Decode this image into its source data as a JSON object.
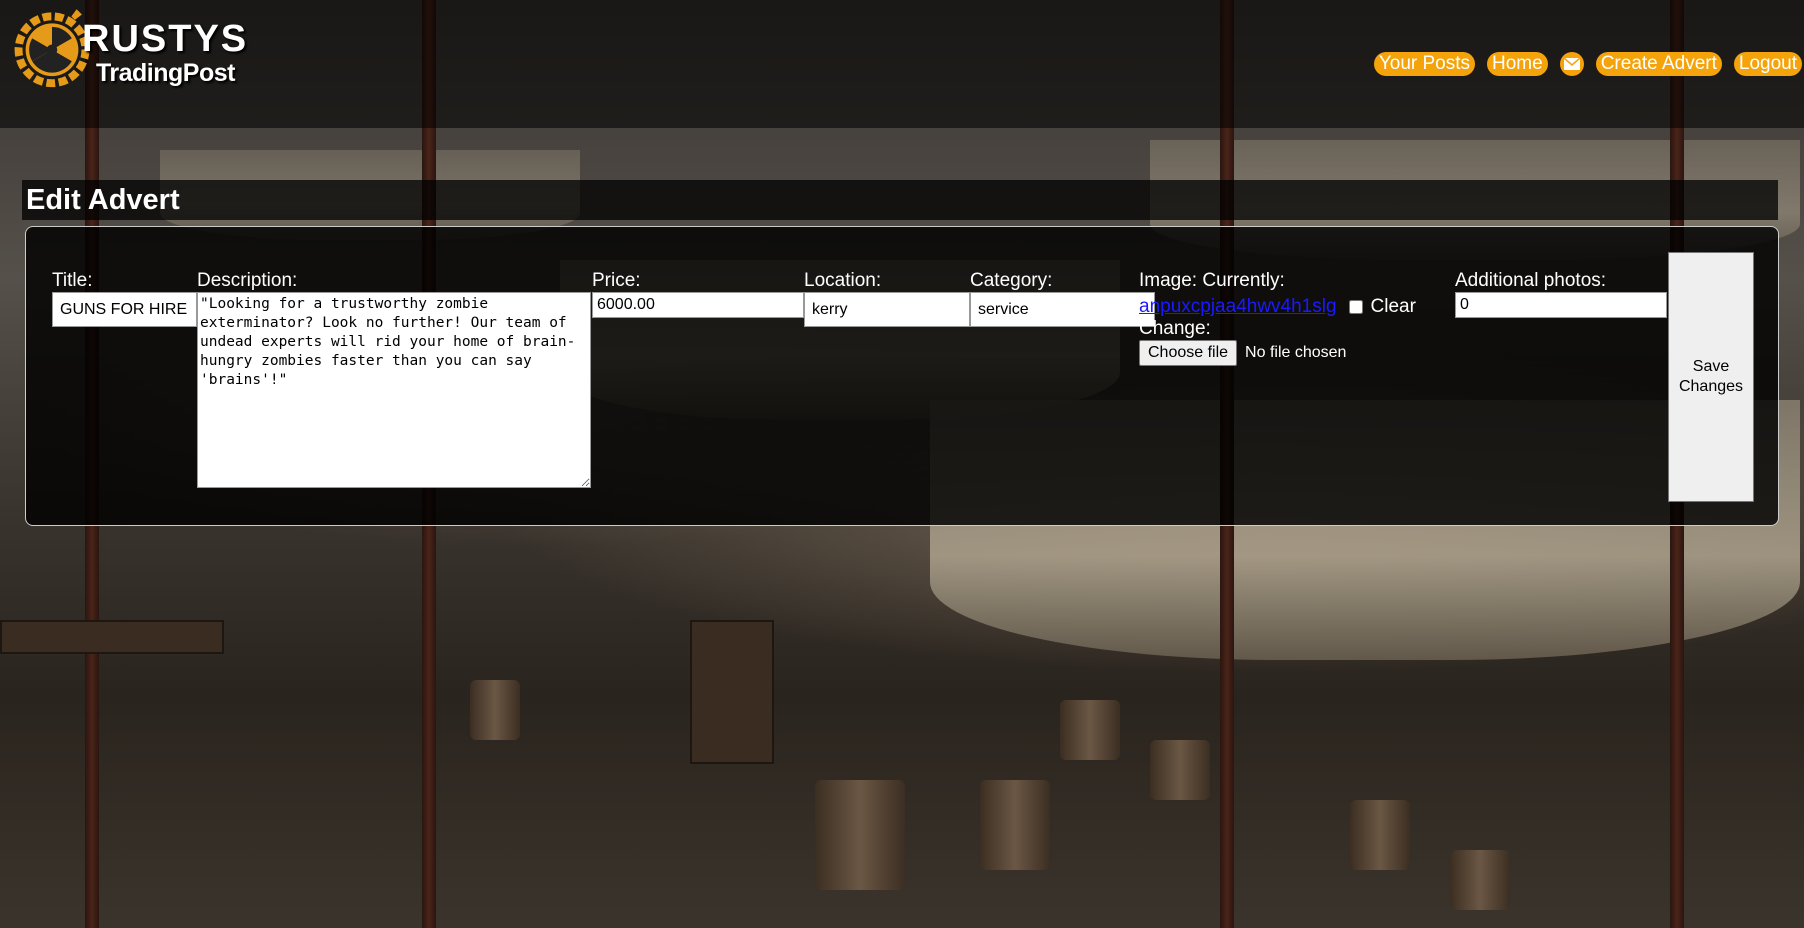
{
  "brand": {
    "name": "RUSTYS",
    "sub": "TradingPost"
  },
  "nav": {
    "your_posts": "Your Posts",
    "home": "Home",
    "mail_icon": "envelope-icon",
    "create_advert": "Create Advert",
    "logout": "Logout"
  },
  "page": {
    "title": "Edit Advert"
  },
  "form": {
    "title_label": "Title:",
    "title_value": "GUNS FOR HIRE",
    "description_label": "Description:",
    "description_value": "\"Looking for a trustworthy zombie exterminator? Look no further! Our team of undead experts will rid your home of brain-hungry zombies faster than you can say 'brains'!\"",
    "price_label": "Price:",
    "price_value": "6000.00",
    "location_label": "Location:",
    "location_value": "kerry",
    "category_label": "Category:",
    "category_value": "service",
    "image_label": "Image: Currently:",
    "image_link": "anpuxcpjaa4hwv4h1slg",
    "clear_label": "Clear",
    "change_label": "Change:",
    "file_button": "Choose file",
    "file_status": "No file chosen",
    "photos_label": "Additional photos:",
    "photos_value": "0",
    "save_button": "Save Changes"
  },
  "colors": {
    "accent": "#f5a30a",
    "link": "#1a1aff"
  }
}
